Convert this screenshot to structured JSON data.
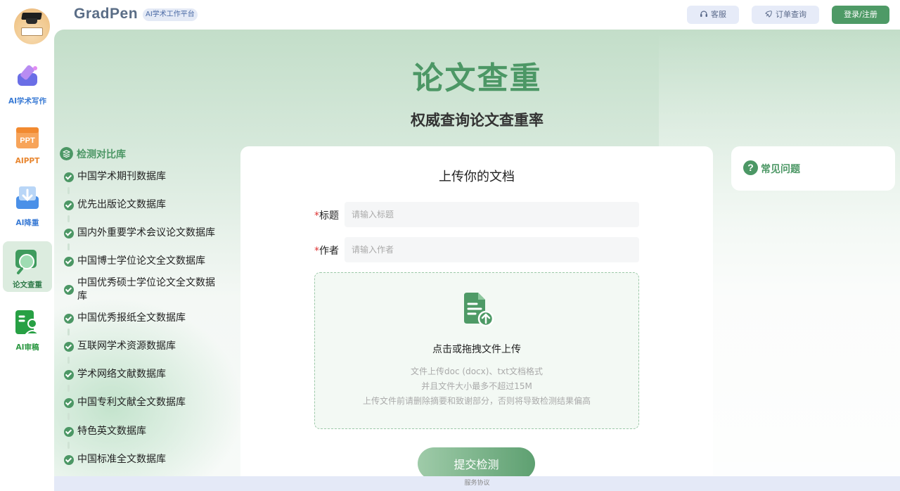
{
  "brand": {
    "name": "GradPen",
    "tag": "AI学术工作平台"
  },
  "header": {
    "service_label": "客服",
    "order_label": "订单查询",
    "login_label": "登录/注册"
  },
  "sidebar": {
    "items": [
      {
        "label": "AI学术写作",
        "color": "#3a7bd5"
      },
      {
        "label": "AIPPT",
        "color": "#e8862f"
      },
      {
        "label": "AI降重",
        "color": "#3a7bd5"
      },
      {
        "label": "论文查重",
        "color": "#2f7a49"
      },
      {
        "label": "AI审稿",
        "color": "#2f9a45"
      }
    ]
  },
  "hero": {
    "title": "论文查重",
    "subtitle": "权威查询论文查重率"
  },
  "databases": {
    "header": "检测对比库",
    "items": [
      "中国学术期刊数据库",
      "优先出版论文数据库",
      "国内外重要学术会议论文数据库",
      "中国博士学位论文全文数据库",
      "中国优秀硕士学位论文全文数据库",
      "中国优秀报纸全文数据库",
      "互联网学术资源数据库",
      "学术网络文献数据库",
      "中国专利文献全文数据库",
      "特色英文数据库",
      "中国标准全文数据库"
    ]
  },
  "upload": {
    "title": "上传你的文档",
    "required_mark": "*",
    "title_label": "标题",
    "title_placeholder": "请输入标题",
    "author_label": "作者",
    "author_placeholder": "请输入作者",
    "drop_text": "点击或拖拽文件上传",
    "hint1": "文件上传doc (docx)、txt文档格式",
    "hint2": "并且文件大小最多不超过15M",
    "hint3": "上传文件前请删除摘要和致谢部分，否则将导致检测结果偏高",
    "submit_label": "提交检测"
  },
  "faq": {
    "title": "常见问题",
    "icon": "?"
  },
  "footer": {
    "text": "服务协议"
  },
  "colors": {
    "accent": "#4c9765",
    "login_bg": "#4e9a66"
  }
}
